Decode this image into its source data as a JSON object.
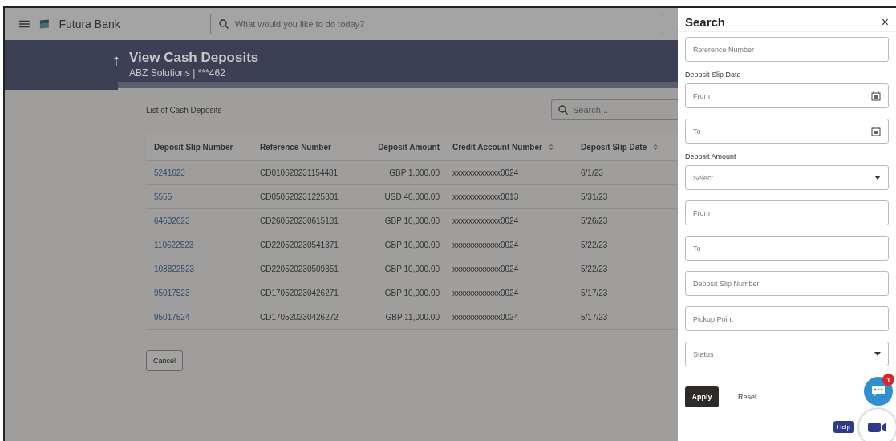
{
  "topbar": {
    "brand": "Futura Bank",
    "search": {
      "placeholder": "What would you like to do today?"
    }
  },
  "header": {
    "title": "View Cash Deposits",
    "subtitle": "ABZ Solutions | ***462"
  },
  "list": {
    "title": "List of Cash Deposits",
    "search": {
      "placeholder": "Search..."
    },
    "columns": [
      {
        "label": "Deposit Slip Number",
        "sortable": false,
        "kind": "link"
      },
      {
        "label": "Reference Number",
        "sortable": false,
        "kind": "text"
      },
      {
        "label": "Deposit Amount",
        "sortable": false,
        "kind": "amount"
      },
      {
        "label": "Credit Account Number",
        "sortable": true,
        "kind": "text"
      },
      {
        "label": "Deposit Slip Date",
        "sortable": true,
        "kind": "text"
      }
    ],
    "rows": [
      [
        "5241623",
        "CD010620231154481",
        "GBP 1,000.00",
        "xxxxxxxxxxxx0024",
        "6/1/23"
      ],
      [
        "5555",
        "CD050520231225301",
        "USD 40,000.00",
        "xxxxxxxxxxxx0013",
        "5/31/23"
      ],
      [
        "64632623",
        "CD260520230615131",
        "GBP 10,000.00",
        "xxxxxxxxxxxx0024",
        "5/26/23"
      ],
      [
        "110622523",
        "CD220520230541371",
        "GBP 10,000.00",
        "xxxxxxxxxxxx0024",
        "5/22/23"
      ],
      [
        "103822523",
        "CD220520230509351",
        "GBP 10,000.00",
        "xxxxxxxxxxxx0024",
        "5/22/23"
      ],
      [
        "95017523",
        "CD170520230426271",
        "GBP 10,000.00",
        "xxxxxxxxxxxx0024",
        "5/17/23"
      ],
      [
        "95017524",
        "CD170520230426272",
        "GBP 11,000.00",
        "xxxxxxxxxxxx0024",
        "5/17/23"
      ]
    ],
    "cancel": "Cancel"
  },
  "panel": {
    "title": "Search",
    "close": "×",
    "fields": [
      {
        "kind": "text",
        "placeholder": "Reference Number"
      },
      {
        "kind": "label",
        "text": "Deposit Slip Date"
      },
      {
        "kind": "date",
        "placeholder": "From"
      },
      {
        "kind": "date",
        "placeholder": "To"
      },
      {
        "kind": "label",
        "text": "Deposit Amount"
      },
      {
        "kind": "select",
        "placeholder": "Select"
      },
      {
        "kind": "text",
        "placeholder": "From"
      },
      {
        "kind": "text",
        "placeholder": "To"
      },
      {
        "kind": "text",
        "placeholder": "Deposit Slip Number"
      },
      {
        "kind": "text",
        "placeholder": "Pickup Point"
      },
      {
        "kind": "select",
        "placeholder": "Status"
      }
    ],
    "apply": "Apply",
    "reset": "Reset"
  },
  "chat": {
    "badge": "1"
  },
  "help": "Help"
}
